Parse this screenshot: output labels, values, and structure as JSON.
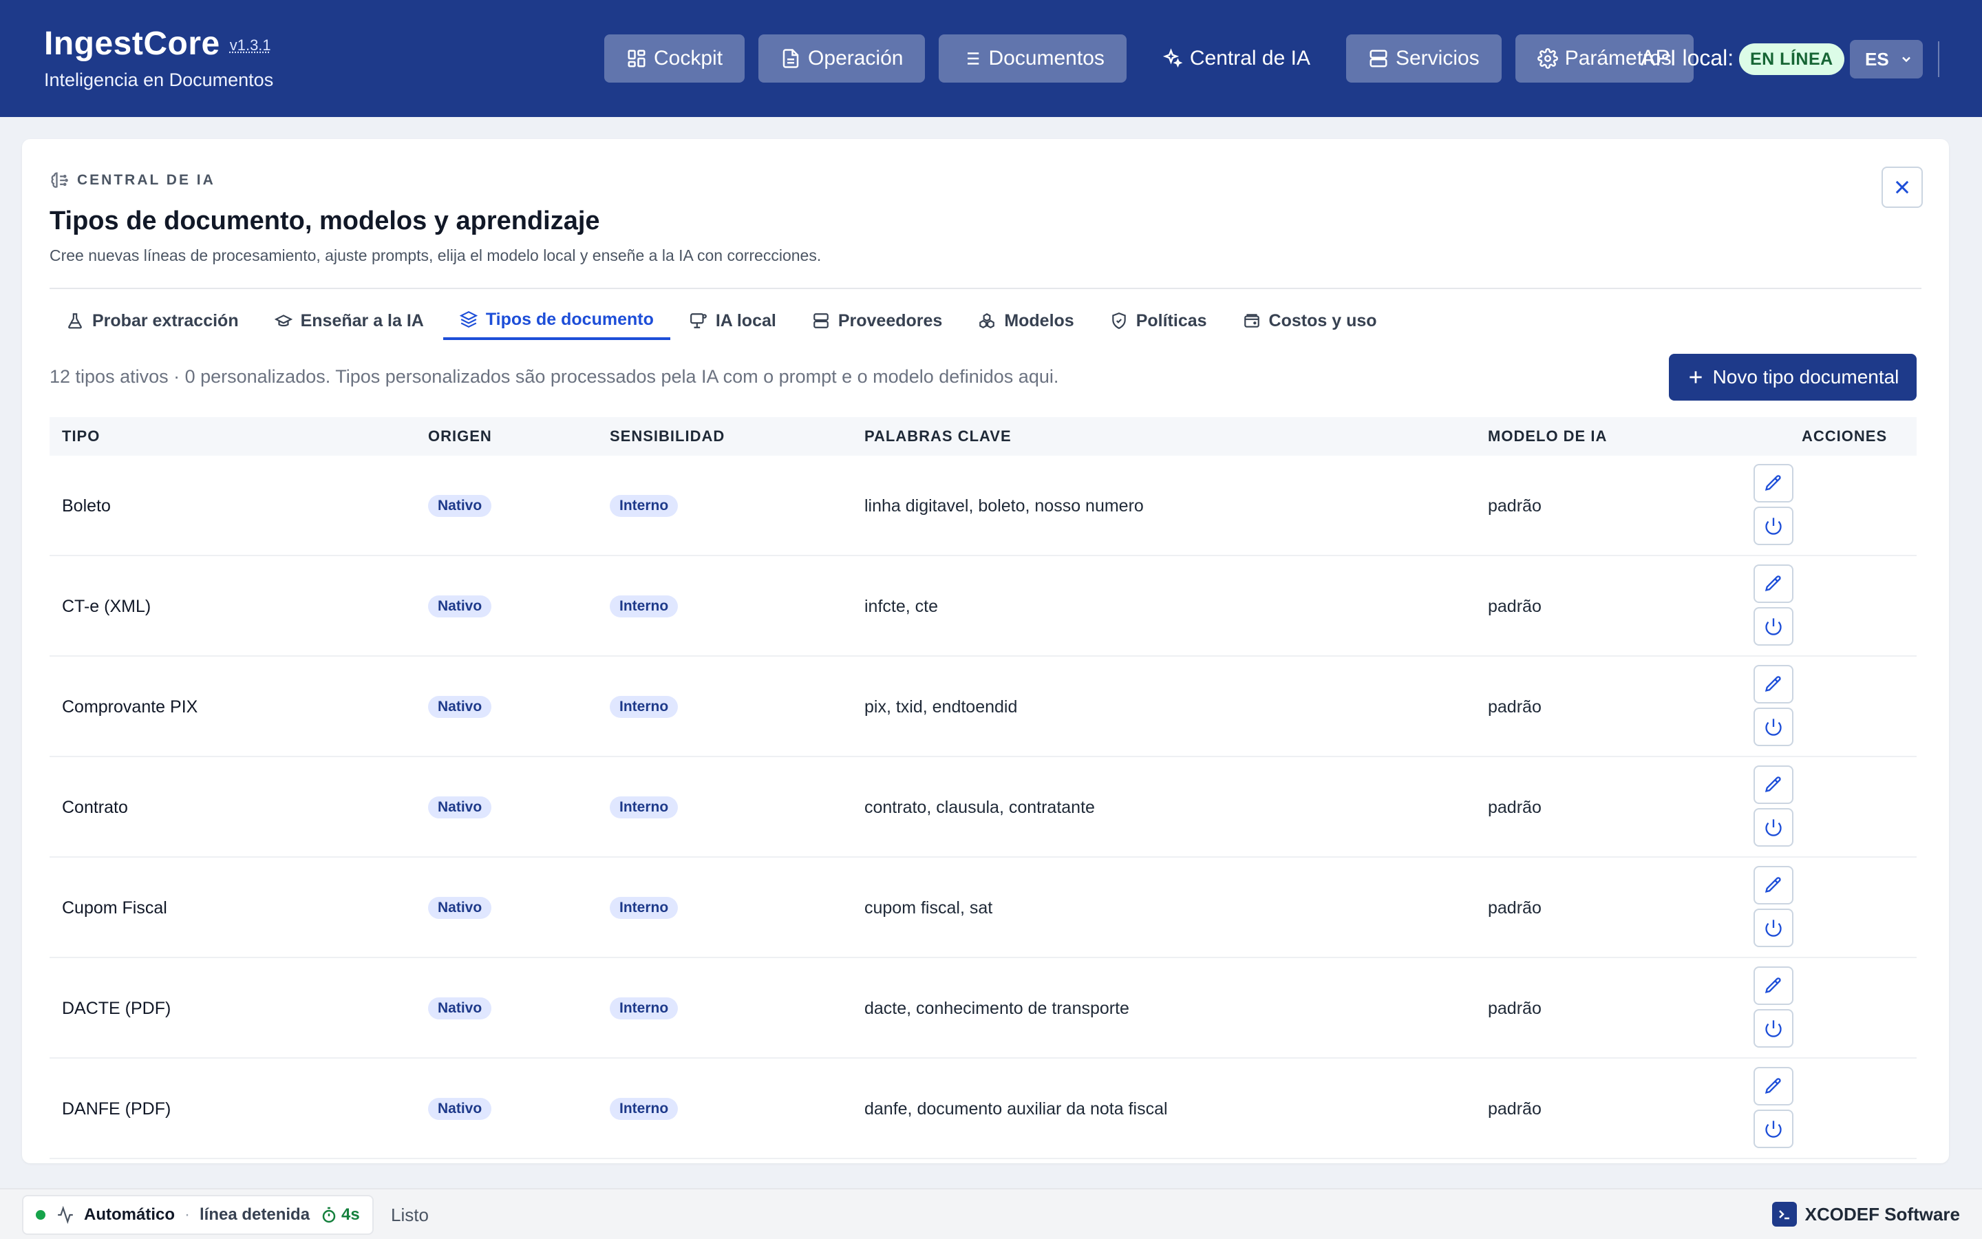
{
  "header": {
    "app_name": "IngestCore",
    "version": "v1.3.1",
    "subtitle": "Inteligencia en Documentos",
    "nav": [
      {
        "label": "Cockpit",
        "icon": "grid-icon"
      },
      {
        "label": "Operación",
        "icon": "document-icon"
      },
      {
        "label": "Documentos",
        "icon": "list-icon"
      },
      {
        "label": "Central de IA",
        "icon": "sparkles-icon"
      },
      {
        "label": "Servicios",
        "icon": "server-icon"
      },
      {
        "label": "Parámetros",
        "icon": "gear-icon"
      }
    ],
    "api_label": "API local:",
    "api_status": "EN LÍNEA",
    "language": "ES"
  },
  "panel": {
    "eyebrow": "CENTRAL DE IA",
    "title": "Tipos de documento, modelos y aprendizaje",
    "description": "Cree nuevas líneas de procesamiento, ajuste prompts, elija el modelo local y enseñe a la IA con correcciones.",
    "tabs": [
      {
        "label": "Probar extracción",
        "icon": "flask-icon"
      },
      {
        "label": "Enseñar a la IA",
        "icon": "graduation-cap-icon"
      },
      {
        "label": "Tipos de documento",
        "icon": "layers-icon",
        "active": true
      },
      {
        "label": "IA local",
        "icon": "monitor-icon"
      },
      {
        "label": "Proveedores",
        "icon": "server-icon"
      },
      {
        "label": "Modelos",
        "icon": "boxes-icon"
      },
      {
        "label": "Políticas",
        "icon": "shield-icon"
      },
      {
        "label": "Costos y uso",
        "icon": "wallet-icon"
      }
    ],
    "summary": "12 tipos ativos · 0 personalizados. Tipos personalizados são processados pela IA com o prompt e o modelo definidos aqui.",
    "new_button": "Novo tipo documental"
  },
  "table": {
    "headers": {
      "type": "TIPO",
      "origin": "ORIGEN",
      "sensitivity": "SENSIBILIDAD",
      "keywords": "PALABRAS CLAVE",
      "model": "MODELO DE IA",
      "actions": "ACCIONES"
    },
    "rows": [
      {
        "type": "Boleto",
        "origin": "Nativo",
        "sensitivity": "Interno",
        "keywords": "linha digitavel, boleto, nosso numero",
        "model": "padrão"
      },
      {
        "type": "CT-e (XML)",
        "origin": "Nativo",
        "sensitivity": "Interno",
        "keywords": "infcte, cte",
        "model": "padrão"
      },
      {
        "type": "Comprovante PIX",
        "origin": "Nativo",
        "sensitivity": "Interno",
        "keywords": "pix, txid, endtoendid",
        "model": "padrão"
      },
      {
        "type": "Contrato",
        "origin": "Nativo",
        "sensitivity": "Interno",
        "keywords": "contrato, clausula, contratante",
        "model": "padrão"
      },
      {
        "type": "Cupom Fiscal",
        "origin": "Nativo",
        "sensitivity": "Interno",
        "keywords": "cupom fiscal, sat",
        "model": "padrão"
      },
      {
        "type": "DACTE (PDF)",
        "origin": "Nativo",
        "sensitivity": "Interno",
        "keywords": "dacte, conhecimento de transporte",
        "model": "padrão"
      },
      {
        "type": "DANFE (PDF)",
        "origin": "Nativo",
        "sensitivity": "Interno",
        "keywords": "danfe, documento auxiliar da nota fiscal",
        "model": "padrão"
      }
    ]
  },
  "statusbar": {
    "mode": "Automático",
    "separator": "·",
    "line_status": "línea detenida",
    "timer": "4s",
    "ready": "Listo",
    "vendor": "XCODEF Software"
  },
  "colors": {
    "header_bg": "#1e3a8a",
    "accent": "#1d4ed8",
    "online_badge": "#dcfce7",
    "status_dot": "#16a34a"
  }
}
